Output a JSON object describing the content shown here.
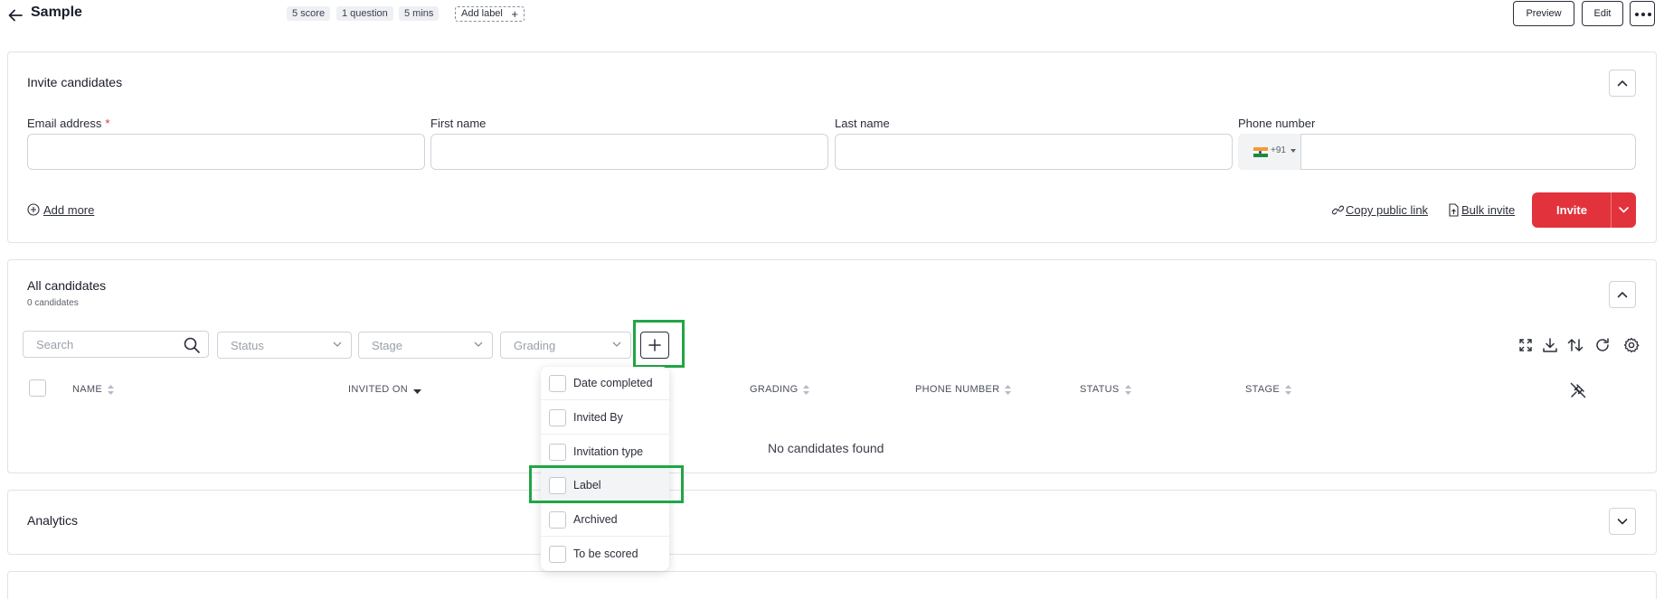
{
  "header": {
    "title": "Sample",
    "chips": [
      "5 score",
      "1 question",
      "5 mins"
    ],
    "add_label": "Add label",
    "preview_label": "Preview",
    "edit_label": "Edit"
  },
  "invite": {
    "title": "Invite candidates",
    "email_label": "Email address",
    "required_mark": "*",
    "first_name_label": "First name",
    "last_name_label": "Last name",
    "phone_label": "Phone number",
    "phone_code": "+91",
    "add_more": "Add more",
    "copy_public_link": "Copy public link",
    "bulk_invite": "Bulk invite",
    "invite_button": "Invite"
  },
  "candidates": {
    "title": "All candidates",
    "count": "0 candidates",
    "search_placeholder": "Search",
    "filters": [
      "Status",
      "Stage",
      "Grading"
    ],
    "columns": [
      "NAME",
      "INVITED ON",
      "GRADING",
      "PHONE NUMBER",
      "STATUS",
      "STAGE"
    ],
    "empty_message": "No candidates found"
  },
  "column_menu": {
    "items": [
      "Date completed",
      "Invited By",
      "Invitation type",
      "Label",
      "Archived",
      "To be scored"
    ]
  },
  "analytics": {
    "title": "Analytics"
  },
  "colors": {
    "accent": "#e2333c",
    "highlight": "#22a546"
  }
}
